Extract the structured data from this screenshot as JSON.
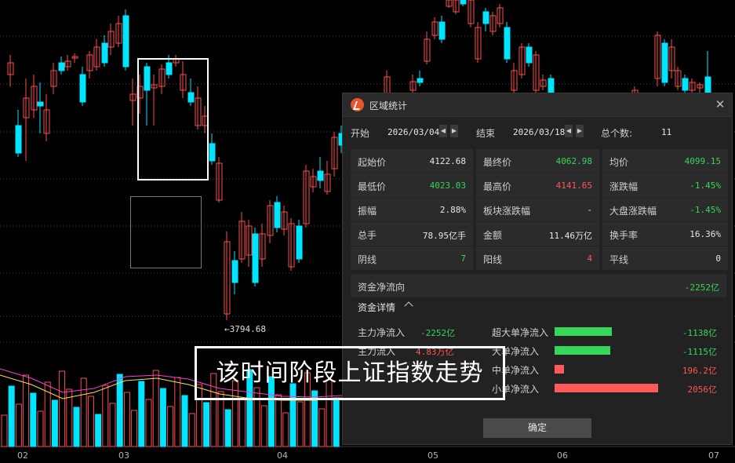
{
  "chart": {
    "low_marker": "←3794.68",
    "date_labels": [
      "02",
      "03",
      "04",
      "05",
      "06",
      "07"
    ]
  },
  "dialog": {
    "title": "区域统计",
    "start_label": "开始",
    "start_date": "2026/03/04",
    "end_label": "结束",
    "end_date": "2026/03/18",
    "count_label": "总个数:",
    "count_value": "11",
    "stats": [
      {
        "label": "起始价",
        "value": "4122.68",
        "color": "white"
      },
      {
        "label": "最终价",
        "value": "4062.98",
        "color": "green"
      },
      {
        "label": "均价",
        "value": "4099.15",
        "color": "green"
      },
      {
        "label": "最低价",
        "value": "4023.03",
        "color": "green"
      },
      {
        "label": "最高价",
        "value": "4141.65",
        "color": "red"
      },
      {
        "label": "涨跌幅",
        "value": "-1.45%",
        "color": "green"
      },
      {
        "label": "振幅",
        "value": "2.88%",
        "color": "white"
      },
      {
        "label": "板块涨跌幅",
        "value": "-",
        "color": "white"
      },
      {
        "label": "大盘涨跌幅",
        "value": "-1.45%",
        "color": "green"
      },
      {
        "label": "总手",
        "value": "78.95亿手",
        "color": "white"
      },
      {
        "label": "金额",
        "value": "11.46万亿",
        "color": "white"
      },
      {
        "label": "换手率",
        "value": "16.36%",
        "color": "white"
      },
      {
        "label": "阴线",
        "value": "7",
        "color": "green"
      },
      {
        "label": "阳线",
        "value": "4",
        "color": "red"
      },
      {
        "label": "平线",
        "value": "0",
        "color": "white"
      }
    ],
    "flow_label": "资金净流向",
    "flow_value": "-2252亿",
    "details_label": "资金详情",
    "details_left": [
      {
        "label": "主力净流入",
        "value": "-2252亿",
        "color": "green"
      },
      {
        "label": "主力流入",
        "value": "4.83万亿",
        "color": "red"
      }
    ],
    "details_right": [
      {
        "label": "超大单净流入",
        "value": "-1138亿",
        "color": "green",
        "fraction": 0.55
      },
      {
        "label": "大单净流入",
        "value": "-1115亿",
        "color": "green",
        "fraction": 0.54
      },
      {
        "label": "中单净流入",
        "value": "196.2亿",
        "color": "red",
        "fraction": 0.09
      },
      {
        "label": "小单净流入",
        "value": "2056亿",
        "color": "red",
        "fraction": 1.0
      }
    ],
    "ok_label": "确定"
  },
  "caption": "该时间阶段上证指数走势",
  "colors": {
    "up": "#ff4d4d",
    "down": "#00e5ff",
    "green_bar": "#35d65a",
    "red_bar": "#ff5a5a"
  }
}
